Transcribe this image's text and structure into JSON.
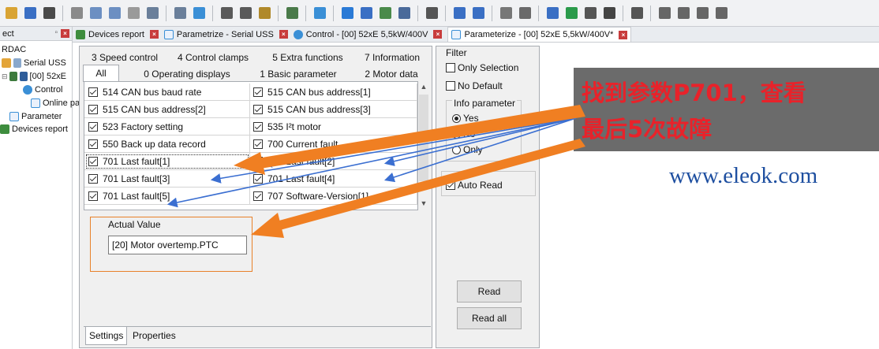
{
  "toolbar": {
    "icons": [
      "open-icon",
      "save-icon",
      "network-icon",
      "cut-icon",
      "copy-icon",
      "paste-icon",
      "delete-icon",
      "window-icon",
      "window2-icon",
      "zoom-icon",
      "print-icon",
      "print2-icon",
      "tool-icon",
      "tree-icon",
      "filter-icon",
      "online-icon",
      "settings-icon",
      "table-icon",
      "monitor-icon",
      "meter-icon",
      "device-icon",
      "device2-icon",
      "wizard-icon",
      "scan-icon",
      "network2-icon",
      "play-icon",
      "record-icon",
      "stop-icon",
      "step-icon",
      "first-icon",
      "prev-icon",
      "next-icon",
      "last-icon"
    ]
  },
  "tree": {
    "header": "ect",
    "pin": "꯱",
    "items": [
      {
        "label": "RDAC"
      },
      {
        "label": "Serial USS"
      },
      {
        "label": "[00] 52xE"
      },
      {
        "label": "Control"
      },
      {
        "label": "Online pa"
      },
      {
        "label": "Parameter"
      },
      {
        "label": "Devices report"
      }
    ]
  },
  "doctabs": [
    {
      "label": "Devices report"
    },
    {
      "label": "Parametrize - Serial USS"
    },
    {
      "label": "Control - [00] 52xE 5,5kW/400V"
    },
    {
      "label": "Parameterize - [00] 52xE 5,5kW/400V*"
    }
  ],
  "param_tabs": {
    "row1": [
      "3 Speed control",
      "4 Control clamps",
      "5 Extra functions",
      "7 Information"
    ],
    "row2": [
      "All",
      "0 Operating displays",
      "1 Basic parameter",
      "2 Motor data"
    ]
  },
  "grid_rows": [
    {
      "left": "514  CAN  bus baud rate",
      "right": "515  CAN bus address[1]"
    },
    {
      "left": "515  CAN bus address[2]",
      "right": "515  CAN bus address[3]"
    },
    {
      "left": "523  Factory setting",
      "right": "535  I²t motor"
    },
    {
      "left": "550  Back up data record",
      "right": "700  Current fault"
    },
    {
      "left": "701  Last fault[1]",
      "right": "701  Last fault[2]"
    },
    {
      "left": "701  Last fault[3]",
      "right": "701  Last fault[4]"
    },
    {
      "left": "701  Last fault[5]",
      "right": "707  Software-Version[1]"
    }
  ],
  "actual_value": {
    "label": "Actual Value",
    "value": "[20] Motor overtemp.PTC"
  },
  "bottom_tabs": [
    "Settings",
    "Properties"
  ],
  "filter": {
    "title": "Filter",
    "only_selection": "Only Selection",
    "no_default": "No Default",
    "info_title": "Info parameter",
    "options": [
      "Yes",
      "No",
      "Only"
    ],
    "auto_read": "Auto Read",
    "read": "Read",
    "read_all": "Read all"
  },
  "annotation": {
    "line1": "找到参数P701，查看",
    "line2": "最后5次故障",
    "watermark": "www.eleok.com"
  },
  "colors": {
    "arrow_orange": "#f07f22",
    "arrow_blue": "#3b6fd1",
    "annotation_red": "#e8222a",
    "callout_bg": "#6b6b6b",
    "watermark_blue": "#1e4fa0"
  }
}
